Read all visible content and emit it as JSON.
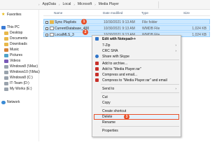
{
  "address": {
    "crumbs": [
      "AppData",
      "Local",
      "Microsoft",
      "Media Player"
    ]
  },
  "sidebar": {
    "items": [
      {
        "label": "Favorites",
        "icon": "star-icon"
      },
      {
        "label": "This PC",
        "icon": "computer-icon"
      },
      {
        "label": "Desktop",
        "icon": "folder-icon"
      },
      {
        "label": "Documents",
        "icon": "folder-icon"
      },
      {
        "label": "Downloads",
        "icon": "folder-icon"
      },
      {
        "label": "Music",
        "icon": "music-icon"
      },
      {
        "label": "Pictures",
        "icon": "pictures-icon"
      },
      {
        "label": "Videos",
        "icon": "videos-icon"
      },
      {
        "label": "Windows8 (\\\\Mac)",
        "icon": "network-drive-icon"
      },
      {
        "label": "Windows10 (\\\\Mac)",
        "icon": "network-drive-icon"
      },
      {
        "label": "Windows8 (C:)",
        "icon": "drive-icon"
      },
      {
        "label": "IT-Team (D:)",
        "icon": "network-drive-icon"
      },
      {
        "label": "My Works (E:)",
        "icon": "network-drive-icon"
      },
      {
        "label": "Network",
        "icon": "network-icon"
      }
    ]
  },
  "columns": {
    "name": "Name",
    "date": "Date modified",
    "type": "Type",
    "size": "Size"
  },
  "files": [
    {
      "name": "Sync Playlists",
      "date": "10/30/2021 9:13 AM",
      "type": "File folder",
      "size": ""
    },
    {
      "name": "CurrentDatabase_400",
      "date": "10/30/2021 9:13 AM",
      "type": "WMDB File",
      "size": "1,024 KB"
    },
    {
      "name": "LocalMLS_3",
      "date": "10/30/2021 9:13 AM",
      "type": "WMDB File",
      "size": "1,024 KB"
    }
  ],
  "badges": {
    "step1": "1",
    "step2": "2",
    "step3": "3"
  },
  "context_menu": {
    "items": [
      {
        "label": "Edit with Notepad++",
        "bold": true,
        "submenu": false
      },
      {
        "label": "7-Zip",
        "submenu": true
      },
      {
        "label": "CRC SHA",
        "submenu": true
      },
      {
        "label": "Share with Skype",
        "submenu": false
      },
      {
        "label": "Add to archive...",
        "submenu": false
      },
      {
        "label": "Add to \"Media Player.rar\"",
        "submenu": false
      },
      {
        "label": "Compress and email...",
        "submenu": false
      },
      {
        "label": "Compress to \"Media Player.rar\" and email",
        "submenu": false
      },
      {
        "label": "Send to",
        "submenu": true
      },
      {
        "label": "Cut",
        "submenu": false
      },
      {
        "label": "Copy",
        "submenu": false
      },
      {
        "label": "Create shortcut",
        "submenu": false
      },
      {
        "label": "Delete",
        "submenu": false
      },
      {
        "label": "Rename",
        "submenu": false
      },
      {
        "label": "Properties",
        "submenu": false
      }
    ],
    "submenu_arrow": "›"
  },
  "colors": {
    "selection": "#cce8ff",
    "badge": "#e8502a",
    "menu_bg": "#f2f2f2"
  }
}
